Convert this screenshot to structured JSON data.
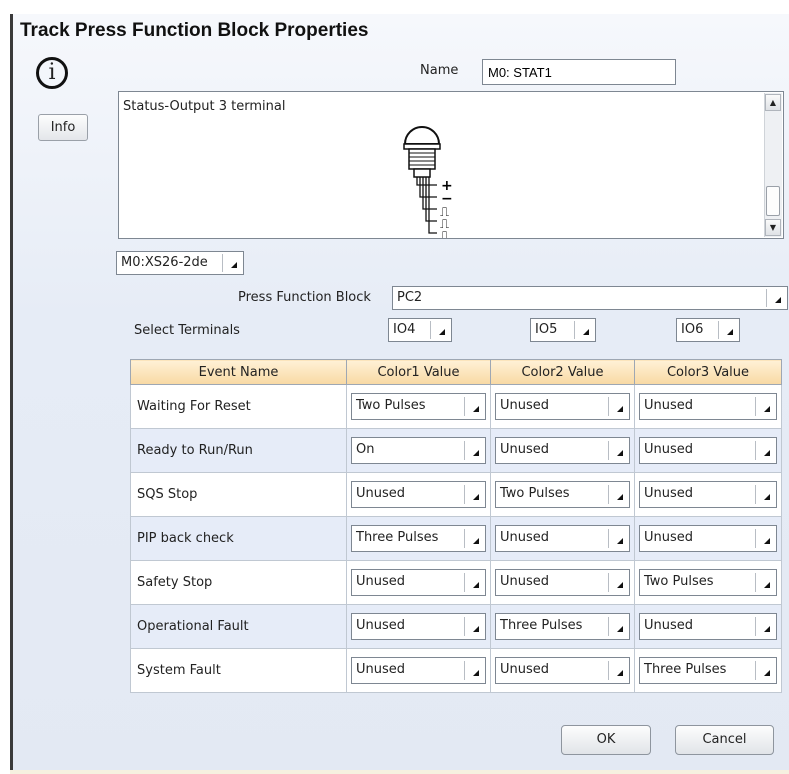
{
  "dialog": {
    "title": "Track Press Function Block Properties",
    "info_label": "Info",
    "name_label": "Name",
    "name_value": "M0: STAT1",
    "description": "Status-Output 3 terminal",
    "device_signs": [
      "+",
      "−",
      "⎍",
      "⎍",
      "⎍"
    ],
    "connector_select": "M0:XS26-2de",
    "press_function_block_label": "Press Function Block",
    "press_function_block_value": "PC2",
    "select_terminals_label": "Select Terminals",
    "terminals": [
      "IO4",
      "IO5",
      "IO6"
    ]
  },
  "table": {
    "headers": [
      "Event Name",
      "Color1 Value",
      "Color2 Value",
      "Color3 Value"
    ],
    "rows": [
      {
        "event": "Waiting For Reset",
        "c1": "Two Pulses",
        "c2": "Unused",
        "c3": "Unused"
      },
      {
        "event": "Ready to Run/Run",
        "c1": "On",
        "c2": "Unused",
        "c3": "Unused"
      },
      {
        "event": "SQS Stop",
        "c1": "Unused",
        "c2": "Two Pulses",
        "c3": "Unused"
      },
      {
        "event": "PIP back check",
        "c1": "Three Pulses",
        "c2": "Unused",
        "c3": "Unused"
      },
      {
        "event": "Safety Stop",
        "c1": "Unused",
        "c2": "Unused",
        "c3": "Two Pulses"
      },
      {
        "event": "Operational Fault",
        "c1": "Unused",
        "c2": "Three Pulses",
        "c3": "Unused"
      },
      {
        "event": "System Fault",
        "c1": "Unused",
        "c2": "Unused",
        "c3": "Three Pulses"
      }
    ]
  },
  "buttons": {
    "ok": "OK",
    "cancel": "Cancel"
  },
  "icons": {
    "info": "info-icon",
    "dropdown": "dropdown-arrow-icon",
    "scroll_up": "scroll-up-icon",
    "scroll_down": "scroll-down-icon",
    "device": "stack-light-device-icon"
  },
  "colors": {
    "header_gradient_top": "#fff1d6",
    "header_gradient_bottom": "#f8d9a4",
    "row_alt": "#e6ecf8",
    "window_bg": "#e6ecf6"
  }
}
